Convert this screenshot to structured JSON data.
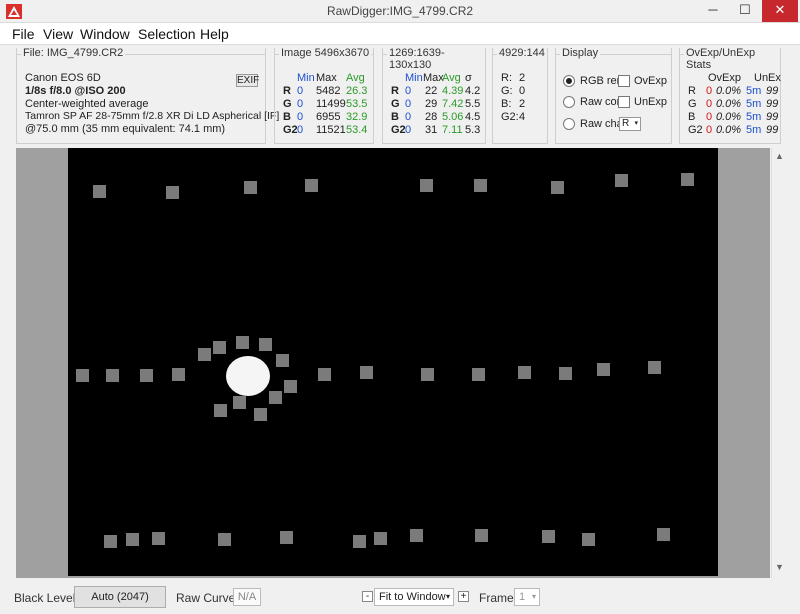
{
  "window": {
    "title": "RawDigger:IMG_4799.CR2",
    "minimize": "─",
    "maximize": "☐",
    "close": "✕"
  },
  "menu": [
    "File",
    "View",
    "Window",
    "Selection",
    "Help"
  ],
  "file_panel": {
    "title": "File: IMG_4799.CR2",
    "camera": "Canon EOS 6D",
    "exposure": "1/8s f/8.0 @ISO 200",
    "metering": "Center-weighted average",
    "lens": "Tamron SP AF 28-75mm f/2.8 XR Di LD Aspherical [IF]",
    "focal": "@75.0 mm (35 mm equivalent: 74.1 mm)",
    "exif_button": "EXIF"
  },
  "image_panel": {
    "title": "Image 5496x3670",
    "headers": [
      "Min",
      "Max",
      "Avg"
    ],
    "rows": [
      {
        "ch": "R",
        "min": "0",
        "max": "5482",
        "avg": "26.3"
      },
      {
        "ch": "G",
        "min": "0",
        "max": "11499",
        "avg": "53.5"
      },
      {
        "ch": "B",
        "min": "0",
        "max": "6955",
        "avg": "32.9"
      },
      {
        "ch": "G2",
        "min": "0",
        "max": "11521",
        "avg": "53.4"
      }
    ]
  },
  "selection_panel": {
    "title": "1269:1639-130x130",
    "headers": [
      "Min",
      "Max",
      "Avg",
      "σ"
    ],
    "rows": [
      {
        "ch": "R",
        "min": "0",
        "max": "22",
        "avg": "4.39",
        "sd": "4.2"
      },
      {
        "ch": "G",
        "min": "0",
        "max": "29",
        "avg": "7.42",
        "sd": "5.5"
      },
      {
        "ch": "B",
        "min": "0",
        "max": "28",
        "avg": "5.06",
        "sd": "4.5"
      },
      {
        "ch": "G2",
        "min": "0",
        "max": "31",
        "avg": "7.11",
        "sd": "5.3"
      }
    ]
  },
  "point_panel": {
    "title": "4929:144",
    "rows": [
      {
        "ch": "R:",
        "val": "2"
      },
      {
        "ch": "G:",
        "val": "0"
      },
      {
        "ch": "B:",
        "val": "2"
      },
      {
        "ch": "G2:",
        "val": "4"
      }
    ]
  },
  "display_panel": {
    "title": "Display",
    "radio_rgb": "RGB ren",
    "radio_raw_comp": "Raw com",
    "radio_raw_channel": "Raw cha",
    "check_ovexp": "OvExp",
    "check_unexp": "UnExp",
    "channel_select": "R"
  },
  "stats_panel": {
    "title": "OvExp/UnExp Stats",
    "headers": [
      "OvExp",
      "UnEx"
    ],
    "rows": [
      {
        "ch": "R",
        "ov_count": "0",
        "ov_pct": "0.0%",
        "un_count": "5m",
        "un_pct": "99"
      },
      {
        "ch": "G",
        "ov_count": "0",
        "ov_pct": "0.0%",
        "un_count": "5m",
        "un_pct": "99"
      },
      {
        "ch": "B",
        "ov_count": "0",
        "ov_pct": "0.0%",
        "un_count": "5m",
        "un_pct": "99"
      },
      {
        "ch": "G2",
        "ov_count": "0",
        "ov_pct": "0.0%",
        "un_count": "5m",
        "un_pct": "99"
      }
    ]
  },
  "statusbar": {
    "black_level_label": "Black Level:",
    "black_level_value": "Auto (2047)",
    "raw_curve_label": "Raw Curve:",
    "raw_curve_value": "N/A",
    "zoom_minus": "-",
    "zoom_value": "Fit to Window",
    "zoom_plus": "+",
    "frame_label": "Frame:",
    "frame_value": "1"
  },
  "colors": {
    "blue": "#1d4fd0",
    "green": "#2a9a2a",
    "red": "#d21818",
    "close": "#c7282d"
  }
}
